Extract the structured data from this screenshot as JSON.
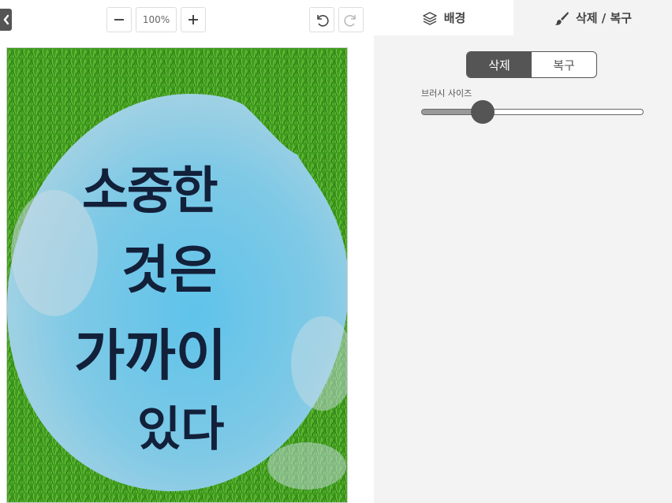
{
  "toolbar": {
    "back_icon": "chevron-left-icon",
    "zoom_out_icon": "minus-icon",
    "zoom_value": "100%",
    "zoom_in_icon": "plus-icon",
    "undo_icon": "undo-icon",
    "redo_icon": "redo-icon"
  },
  "tabs": [
    {
      "label": "배경",
      "icon": "layers-icon",
      "active": false
    },
    {
      "label": "삭제 / 복구",
      "icon": "brush-icon",
      "active": true
    }
  ],
  "mode": {
    "options": [
      "삭제",
      "복구"
    ],
    "selected": "삭제"
  },
  "brush": {
    "label": "브러시 사이즈",
    "value_fraction": 0.25
  },
  "image": {
    "lines": [
      "소중한",
      "것은",
      "가까이",
      "있다"
    ],
    "colors": {
      "grass": "#3f9a1e",
      "stone": "#7ec9e6",
      "ink": "#12203a"
    }
  }
}
